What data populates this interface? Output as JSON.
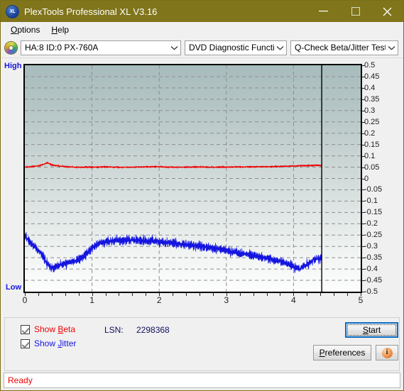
{
  "window": {
    "title": "PlexTools Professional XL V3.16",
    "app_icon": "xl-disc-icon",
    "minimize_label": "Minimize",
    "maximize_label": "Maximize",
    "close_label": "Close",
    "titlebar_color": "#80751a"
  },
  "menubar": {
    "items": [
      {
        "label": "Options",
        "accel": "O"
      },
      {
        "label": "Help",
        "accel": "H"
      }
    ]
  },
  "toolbar": {
    "drive_icon": "optical-disc-icon",
    "drive": {
      "value": "HA:8 ID:0  PX-760A"
    },
    "function": {
      "value": "DVD Diagnostic Functions"
    },
    "test": {
      "value": "Q-Check Beta/Jitter Test"
    }
  },
  "controls": {
    "show_beta": {
      "label": "Show Beta",
      "accel": "B",
      "checked": true,
      "color": "#ee0000"
    },
    "show_jitter": {
      "label": "Show Jitter",
      "accel": "J",
      "checked": true,
      "color": "#1515e0"
    },
    "lsn_label": "LSN:",
    "lsn_value": "2298368",
    "start_label": "Start",
    "start_accel": "S",
    "preferences_label": "Preferences",
    "preferences_accel": "P",
    "info_label": "i"
  },
  "statusbar": {
    "text": "Ready",
    "color": "#ee0000"
  },
  "chart_data": {
    "type": "line",
    "title": "Q-Check Beta/Jitter Test",
    "xlabel": "",
    "ylabel": "",
    "xlim": [
      0,
      5
    ],
    "ylim": [
      -0.5,
      0.5
    ],
    "grid": true,
    "legend_position": "external-checkboxes",
    "left_axis_labels": {
      "top": "High",
      "bottom": "Low"
    },
    "xticks": [
      0,
      1,
      2,
      3,
      4,
      5
    ],
    "yticks": [
      0.5,
      0.45,
      0.4,
      0.35,
      0.3,
      0.25,
      0.2,
      0.15,
      0.1,
      0.05,
      0,
      -0.05,
      -0.1,
      -0.15,
      -0.2,
      -0.25,
      -0.3,
      -0.35,
      -0.4,
      -0.45,
      -0.5
    ],
    "data_end_x": 4.42,
    "series": [
      {
        "name": "Beta",
        "color": "#ee0000",
        "x": [
          0.0,
          0.1,
          0.2,
          0.28,
          0.34,
          0.4,
          0.5,
          0.62,
          0.75,
          0.9,
          1.05,
          1.2,
          1.4,
          1.6,
          1.8,
          2.0,
          2.2,
          2.4,
          2.6,
          2.8,
          3.0,
          3.2,
          3.4,
          3.6,
          3.8,
          4.0,
          4.2,
          4.42
        ],
        "values": [
          0.05,
          0.052,
          0.056,
          0.062,
          0.07,
          0.06,
          0.055,
          0.052,
          0.05,
          0.05,
          0.05,
          0.051,
          0.05,
          0.05,
          0.051,
          0.052,
          0.05,
          0.05,
          0.051,
          0.05,
          0.05,
          0.051,
          0.052,
          0.052,
          0.053,
          0.055,
          0.057,
          0.058
        ],
        "noise_amplitude": 0.006
      },
      {
        "name": "Jitter",
        "color": "#1515e0",
        "x": [
          0.0,
          0.08,
          0.16,
          0.24,
          0.32,
          0.4,
          0.5,
          0.6,
          0.7,
          0.8,
          0.9,
          1.0,
          1.1,
          1.2,
          1.3,
          1.45,
          1.6,
          1.75,
          1.9,
          2.05,
          2.2,
          2.4,
          2.6,
          2.8,
          3.0,
          3.2,
          3.4,
          3.6,
          3.8,
          4.0,
          4.1,
          4.2,
          4.3,
          4.42
        ],
        "values": [
          -0.255,
          -0.285,
          -0.305,
          -0.33,
          -0.37,
          -0.395,
          -0.385,
          -0.375,
          -0.37,
          -0.36,
          -0.34,
          -0.305,
          -0.288,
          -0.28,
          -0.277,
          -0.272,
          -0.272,
          -0.275,
          -0.276,
          -0.28,
          -0.285,
          -0.292,
          -0.298,
          -0.308,
          -0.318,
          -0.33,
          -0.34,
          -0.352,
          -0.365,
          -0.39,
          -0.398,
          -0.38,
          -0.358,
          -0.352
        ],
        "noise_amplitude": 0.03
      }
    ]
  }
}
